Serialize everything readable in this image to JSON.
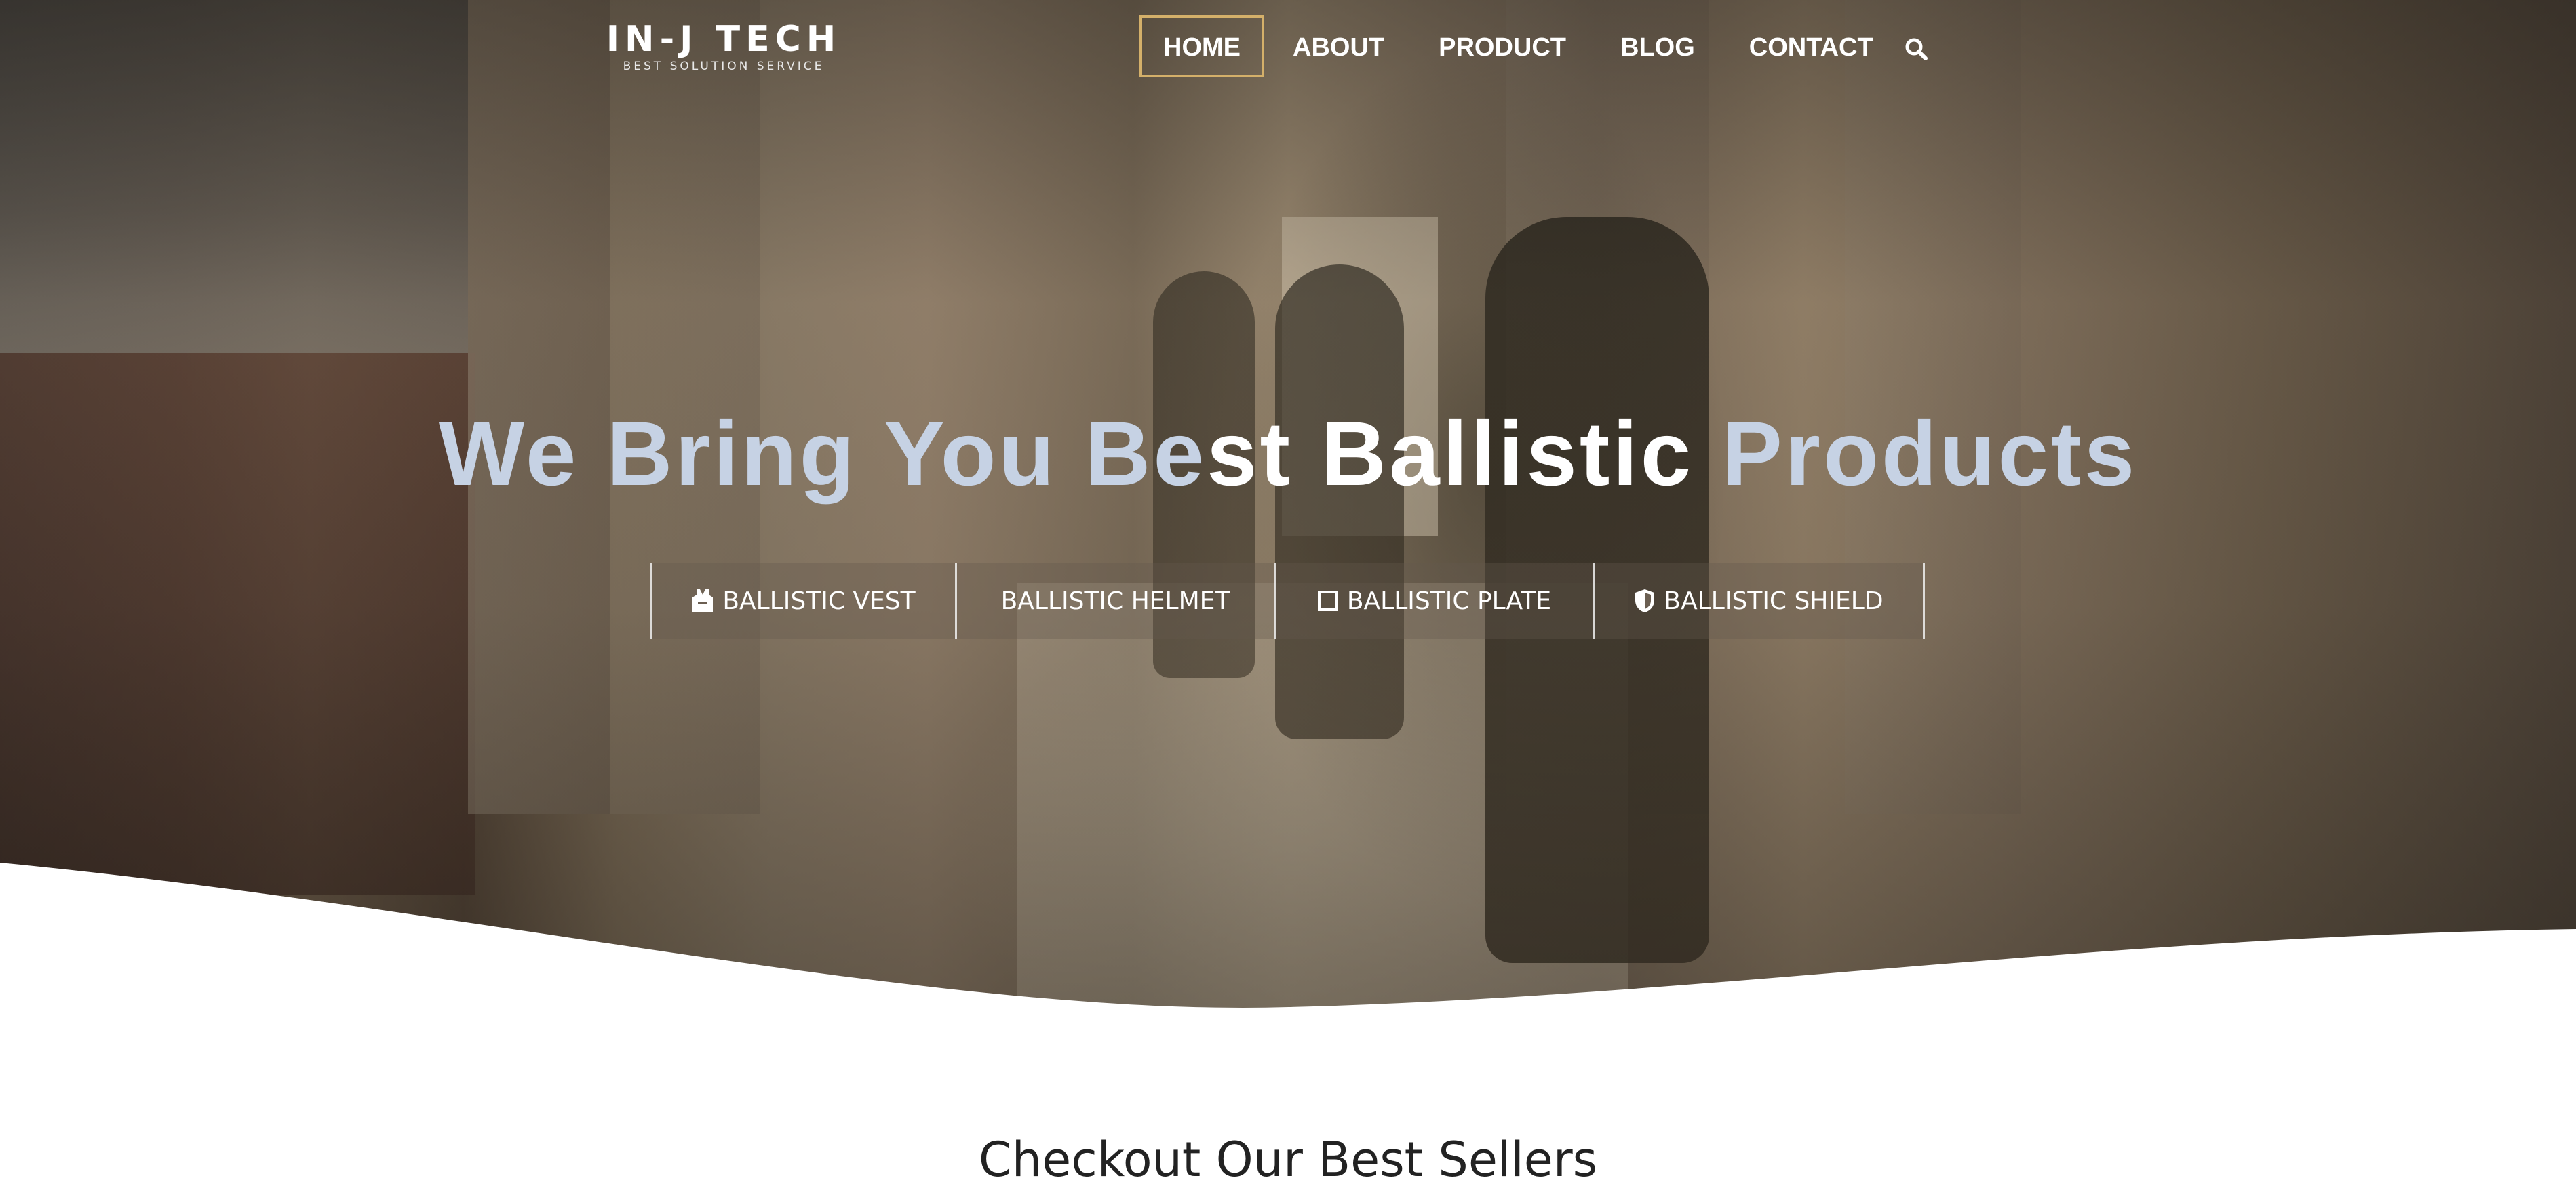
{
  "brand": {
    "name": "IN-J TECH",
    "tagline": "BEST SOLUTION SERVICE"
  },
  "nav": {
    "items": [
      {
        "label": "HOME",
        "active": true
      },
      {
        "label": "ABOUT",
        "active": false
      },
      {
        "label": "PRODUCT",
        "active": false
      },
      {
        "label": "BLOG",
        "active": false
      },
      {
        "label": "CONTACT",
        "active": false
      }
    ],
    "search_icon": "search-icon"
  },
  "hero": {
    "headline_part1": "We Bring You Be",
    "headline_part2": "st Ballistic",
    "headline_part3": " Products",
    "categories": [
      {
        "label": "BALLISTIC VEST",
        "icon": "vest-icon"
      },
      {
        "label": "BALLISTIC HELMET",
        "icon": ""
      },
      {
        "label": "BALLISTIC PLATE",
        "icon": "square-icon"
      },
      {
        "label": "BALLISTIC SHIELD",
        "icon": "shield-icon"
      }
    ]
  },
  "best_sellers": {
    "title": "Checkout Our Best Sellers"
  },
  "colors": {
    "accent": "#d4b06a",
    "headline": "#c6d2e4",
    "text_dark": "#222222"
  }
}
